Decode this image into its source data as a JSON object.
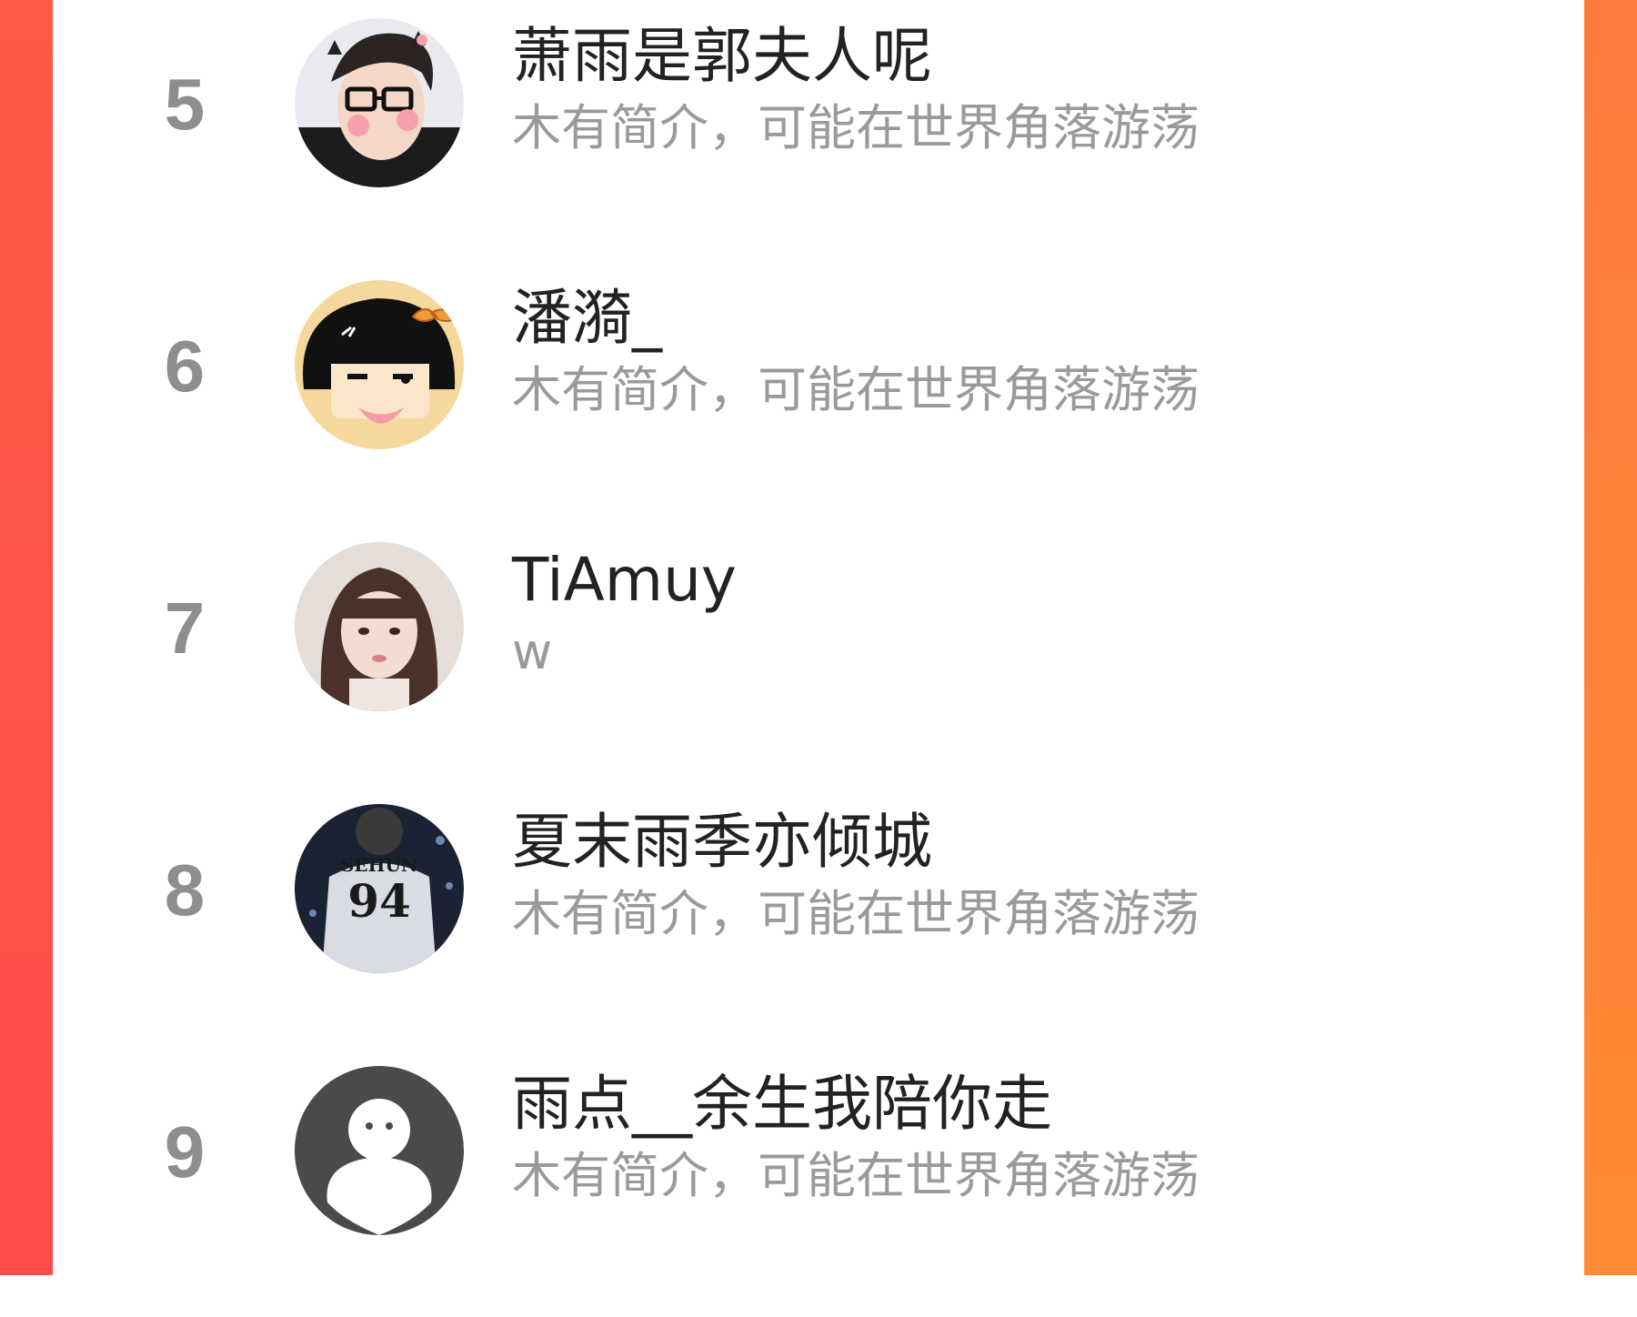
{
  "colors": {
    "left_bar": "#ff4b4a",
    "right_bar": "#ff8a35",
    "rank_text": "#8e8e8e",
    "name_text": "#222222",
    "bio_text": "#9a9a9a"
  },
  "list": [
    {
      "rank": "5",
      "name": "萧雨是郭夫人呢",
      "bio": "木有简介，可能在世界角落游荡",
      "avatar": "avatar-boy-glasses"
    },
    {
      "rank": "6",
      "name": "潘漪_",
      "bio": "木有简介，可能在世界角落游荡",
      "avatar": "avatar-cartoon-girl"
    },
    {
      "rank": "7",
      "name": "TiAmuy",
      "bio": "w",
      "avatar": "avatar-girl-photo"
    },
    {
      "rank": "8",
      "name": "夏末雨季亦倾城",
      "bio": "木有简介，可能在世界角落游荡",
      "avatar": "avatar-jersey-94",
      "avatar_jersey_name": "SEHUN",
      "avatar_jersey_number": "94"
    },
    {
      "rank": "9",
      "name": "雨点__余生我陪你走",
      "bio": "木有简介，可能在世界角落游荡",
      "avatar": "avatar-default-ghost"
    }
  ]
}
